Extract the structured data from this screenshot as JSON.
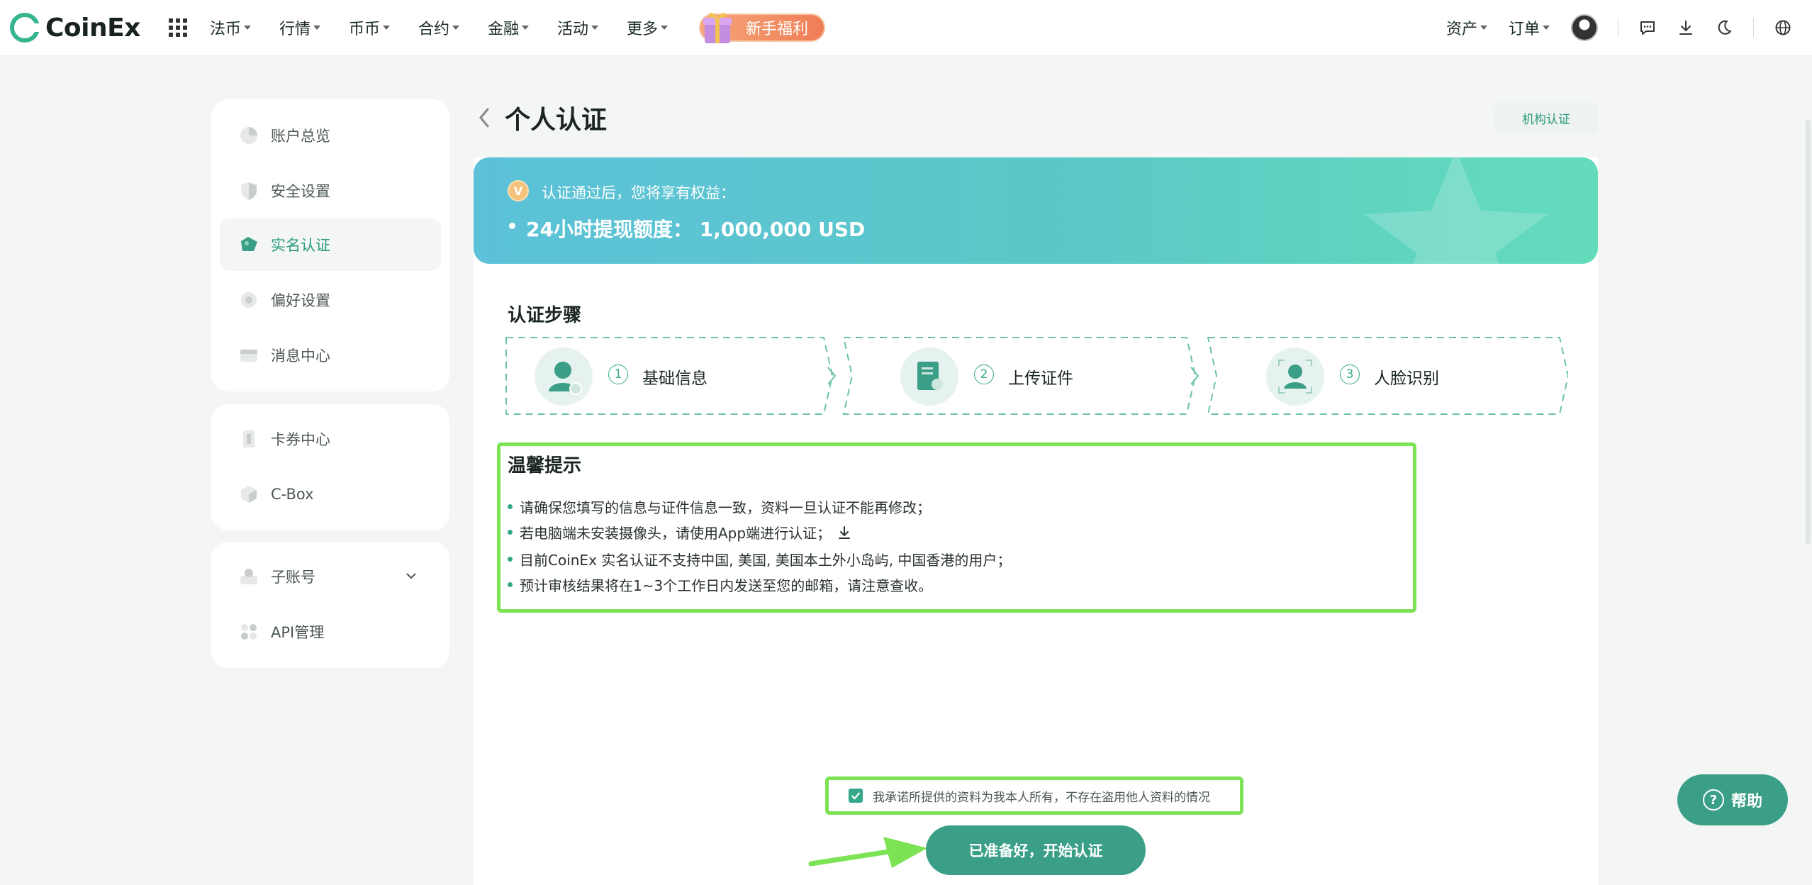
{
  "header": {
    "brand": "CoinEx",
    "nav": [
      "法币",
      "行情",
      "币币",
      "合约",
      "金融",
      "活动",
      "更多"
    ],
    "promo_label": "新手福利",
    "assets_label": "资产",
    "orders_label": "订单"
  },
  "sidebar": {
    "group1": [
      "账户总览",
      "安全设置",
      "实名认证",
      "偏好设置",
      "消息中心"
    ],
    "group2": [
      "卡券中心",
      "C-Box"
    ],
    "group3": [
      "子账号",
      "API管理"
    ],
    "active": "实名认证"
  },
  "page": {
    "title": "个人认证",
    "org_button": "机构认证"
  },
  "banner": {
    "badge": "V",
    "intro": "认证通过后，您将享有权益：",
    "limit": "24小时提现额度：  1,000,000 USD"
  },
  "steps": {
    "title": "认证步骤",
    "items": [
      {
        "num": "1",
        "label": "基础信息"
      },
      {
        "num": "2",
        "label": "上传证件"
      },
      {
        "num": "3",
        "label": "人脸识别"
      }
    ]
  },
  "tips": {
    "title": "温馨提示",
    "items": [
      "请确保您填写的信息与证件信息一致，资料一旦认证不能再修改；",
      "若电脑端未安装摄像头，请使用App端进行认证；",
      "目前CoinEx 实名认证不支持中国, 美国, 美国本土外小岛屿, 中国香港的用户；",
      "预计审核结果将在1~3个工作日内发送至您的邮箱，请注意查收。"
    ]
  },
  "agreement": {
    "checked": true,
    "text": "我承诺所提供的资料为我本人所有，不存在盗用他人资料的情况"
  },
  "start_button": "已准备好，开始认证",
  "help_button": "帮助",
  "colors": {
    "accent": "#3a9f86",
    "highlight": "#7be354"
  }
}
